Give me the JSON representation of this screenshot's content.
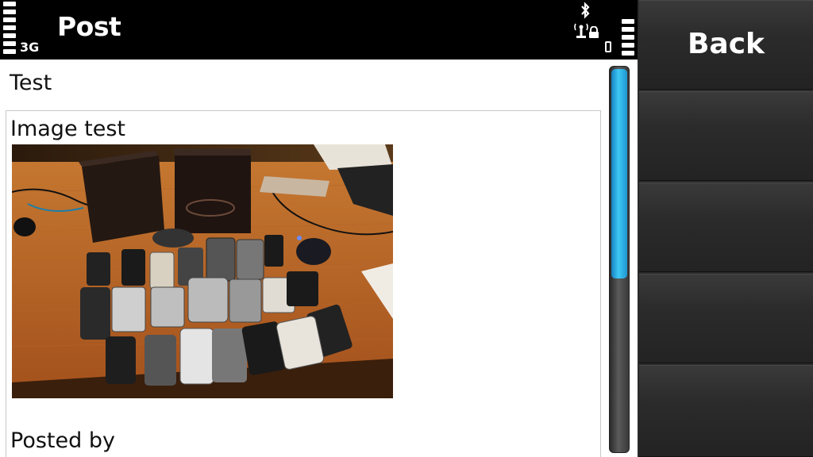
{
  "status_bar": {
    "network_type": "3G",
    "title": "Post",
    "icons": [
      "signal-strength-icon",
      "bluetooth-icon",
      "antenna-icon",
      "keylock-icon",
      "battery-icon"
    ]
  },
  "post": {
    "title": "Test",
    "subtitle": "Image test",
    "image": "photo of many mobile phones and boxes arranged on a wooden desk",
    "posted_by": "Posted by"
  },
  "scrollbar": {
    "position": 0.0,
    "visible_fraction": 0.55
  },
  "softkeys": [
    {
      "label": "Back"
    },
    {
      "label": ""
    },
    {
      "label": ""
    },
    {
      "label": ""
    },
    {
      "label": ""
    }
  ],
  "colors": {
    "accent": "#3ec8f4",
    "softkey_bg": "#2b2b2b",
    "status_bg": "#000000"
  }
}
